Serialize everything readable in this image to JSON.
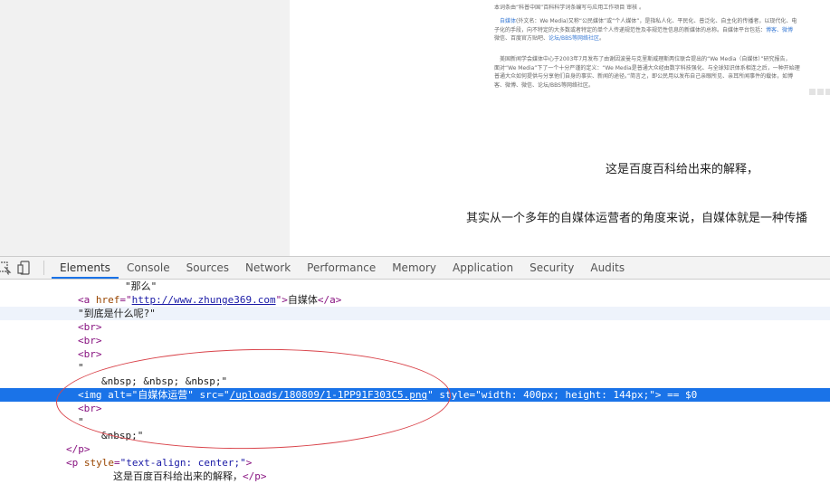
{
  "browser_page": {
    "blurb_line1": "本词条由“科普中国”百科科学词条编写与应用工作项目 审核 。",
    "blurb_p1_a": "自媒体",
    "blurb_p1_b": "(外文名：We Media)又称“公民媒体”或“个人媒体”，是指私人化、平民化、普泛化、自主化的传播者，以现代化、电",
    "blurb_p1_c": "子化的手段，向不特定的大多数或者特定的单个人传递规范性及非规范性信息的新媒体的总称。自媒体平台包括：",
    "blurb_p1_links": "博客、微博",
    "blurb_p1_d": "微信、百度官方贴吧、",
    "blurb_p1_link2": "论坛/BBS等网络社区",
    "blurb_p1_e": "。",
    "blurb_p2_a": "美国新闻学会媒体中心于2003年7月发布了由谢因波曼与克里斯威理斯两位联合提出的“We Media（自媒体）”研究报告，",
    "blurb_p2_b": "面对“We Media”下了一个十分严谨的定义：“We Media是普通大众经由数字科技强化、与全球知识体系相连之后，一种开始理",
    "blurb_p2_c": "普通大众如何提供与分享他们自身的事实、新闻的途径。”简言之，即公民用以发布自己亲眼所见、亲耳所闻事件的载体，如博",
    "blurb_p2_d": "客、微博、微信、论坛/BBS等网络社区。",
    "caption": "这是百度百科给出来的解释，",
    "body_text": "其实从一个多年的自媒体运营者的角度来说，自媒体就是一种传播"
  },
  "devtools": {
    "tabs": [
      "Elements",
      "Console",
      "Sources",
      "Network",
      "Performance",
      "Memory",
      "Application",
      "Security",
      "Audits"
    ],
    "active_tab": "Elements",
    "icons": [
      "inspect-element-icon",
      "device-toolbar-icon"
    ],
    "code": {
      "l0_text": "\"那么\"",
      "l1_open": "<a ",
      "l1_attr": "href",
      "l1_eq": "=\"",
      "l1_url": "http://www.zhunge369.com",
      "l1_close": "\">",
      "l1_text": "自媒体",
      "l1_end": "</a>",
      "l2_text": "\"到底是什么呢?\"",
      "br": "<br>",
      "quote": "\"",
      "nbsp_line": "&nbsp; &nbsp; &nbsp;\"",
      "img_open": "<img ",
      "img_alt_attr": "alt",
      "img_alt_val": "\"自媒体运营\"",
      "img_src_attr": "src",
      "img_src_val": "/uploads/180809/1-1PP91F303C5.png",
      "img_style_attr": "style",
      "img_style_val": "\"width: 400px; height: 144px;\"",
      "img_close": ">",
      "img_dollar": " == $0",
      "nbsp_end": "&nbsp;\"",
      "p_end": "</p>",
      "p_open": "<p ",
      "p_attr": "style",
      "p_val": "\"text-align: center;\"",
      "p_close": ">",
      "p_text": "这是百度百科给出来的解释，",
      "p_end2": "</p>"
    }
  },
  "colors": {
    "selected_row": "#1a73e8",
    "annotation": "#d9434a",
    "tag": "#881280",
    "attr": "#994500"
  }
}
